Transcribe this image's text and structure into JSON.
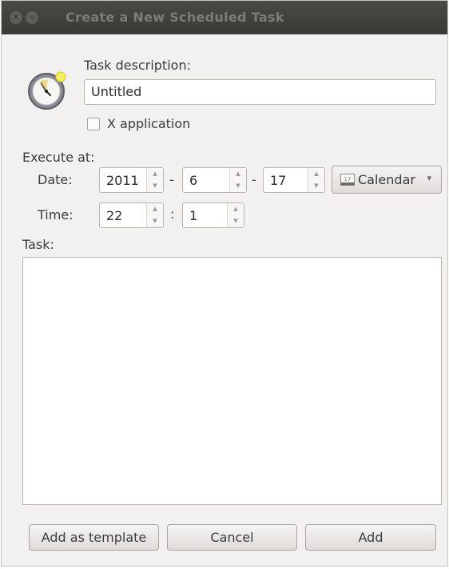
{
  "window": {
    "title": "Create a New Scheduled Task",
    "close_glyph": "✕",
    "minimize_glyph": "–"
  },
  "description": {
    "label": "Task description:",
    "value": "Untitled"
  },
  "x_application": {
    "label": "X application",
    "checked": false
  },
  "execute": {
    "label": "Execute at:",
    "date_label": "Date:",
    "year": "2011",
    "month": "6",
    "day": "17",
    "date_sep": "-",
    "time_label": "Time:",
    "hour": "22",
    "minute": "1",
    "time_sep": ":",
    "calendar_label": "Calendar",
    "calendar_icon_text": "17",
    "caret": "▾",
    "spin_up": "▲",
    "spin_down": "▼"
  },
  "task": {
    "label": "Task:",
    "value": ""
  },
  "buttons": {
    "template": "Add as template",
    "cancel": "Cancel",
    "add": "Add"
  },
  "icons": {
    "app": "clock-icon",
    "calendar": "calendar-icon"
  },
  "colors": {
    "titlebar": "#3c3b37",
    "background": "#f2f1f0"
  }
}
